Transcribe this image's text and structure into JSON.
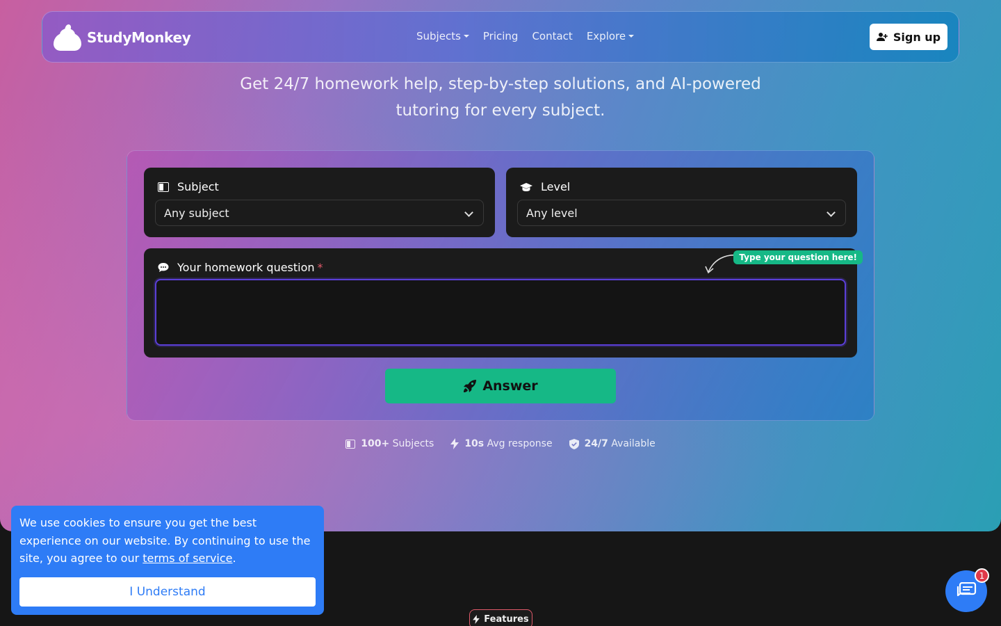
{
  "brand": {
    "name": "StudyMonkey"
  },
  "nav": {
    "links": [
      {
        "label": "Subjects",
        "dropdown": true
      },
      {
        "label": "Pricing",
        "dropdown": false
      },
      {
        "label": "Contact",
        "dropdown": false
      },
      {
        "label": "Explore",
        "dropdown": true
      }
    ],
    "signup_label": "Sign up"
  },
  "hero": {
    "tagline_line1": "Get 24/7 homework help, step-by-step solutions, and AI-powered",
    "tagline_line2": "tutoring for every subject."
  },
  "form": {
    "subject": {
      "label": "Subject",
      "value": "Any subject"
    },
    "level": {
      "label": "Level",
      "value": "Any level"
    },
    "question": {
      "label": "Your homework question",
      "required_mark": "*",
      "value": "",
      "hint": "Type your question here!"
    },
    "answer_label": "Answer"
  },
  "stats": [
    {
      "strong": "100+",
      "text": "Subjects"
    },
    {
      "strong": "10s",
      "text": "Avg response"
    },
    {
      "strong": "24/7",
      "text": "Available"
    }
  ],
  "cookie": {
    "text_before": "We use cookies to ensure you get the best experience on our website. By continuing to use the site, you agree to our ",
    "link_text": "terms of service",
    "text_after": ".",
    "button_label": "I Understand"
  },
  "features_badge": {
    "label": "Features"
  },
  "chat": {
    "unread_count": "1"
  },
  "colors": {
    "accent_green": "#16b886",
    "accent_blue": "#2e7cf6",
    "focus_purple": "#5b3fd8"
  }
}
